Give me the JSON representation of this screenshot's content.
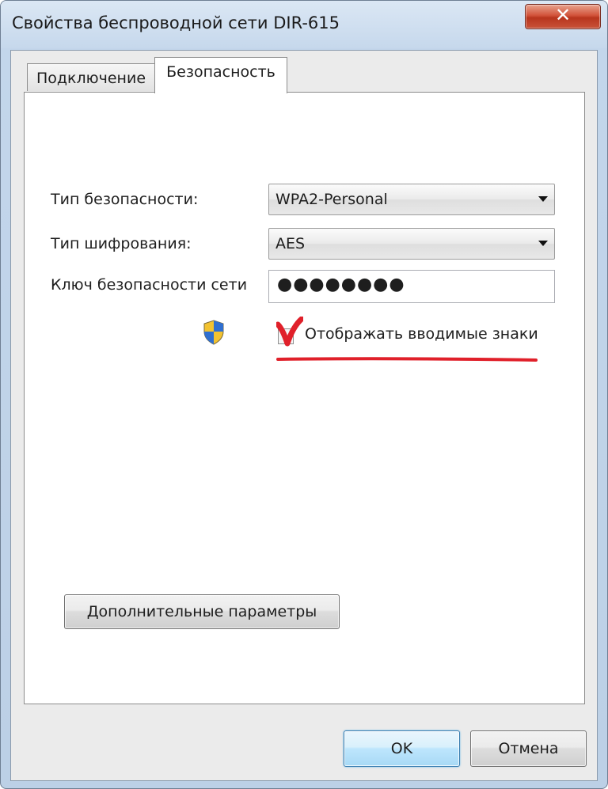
{
  "window": {
    "title": "Свойства беспроводной сети DIR-615",
    "close_glyph": "✕"
  },
  "tabs": [
    {
      "label": "Подключение",
      "selected": false
    },
    {
      "label": "Безопасность",
      "selected": true
    }
  ],
  "security": {
    "security_type_label": "Тип безопасности:",
    "security_type_value": "WPA2-Personal",
    "encryption_type_label": "Тип шифрования:",
    "encryption_type_value": "AES",
    "network_key_label": "Ключ безопасности сети",
    "network_key_value": "●●●●●●●●",
    "show_chars_label": "Отображать вводимые знаки",
    "show_chars_checked": true,
    "shield_icon": "uac-shield-icon"
  },
  "buttons": {
    "advanced": "Дополнительные параметры",
    "ok": "OK",
    "cancel": "Отмена"
  },
  "colors": {
    "annotation_red": "#e0202a",
    "title_bar": "#c6d8ec",
    "ok_button": "#bee6fd"
  }
}
